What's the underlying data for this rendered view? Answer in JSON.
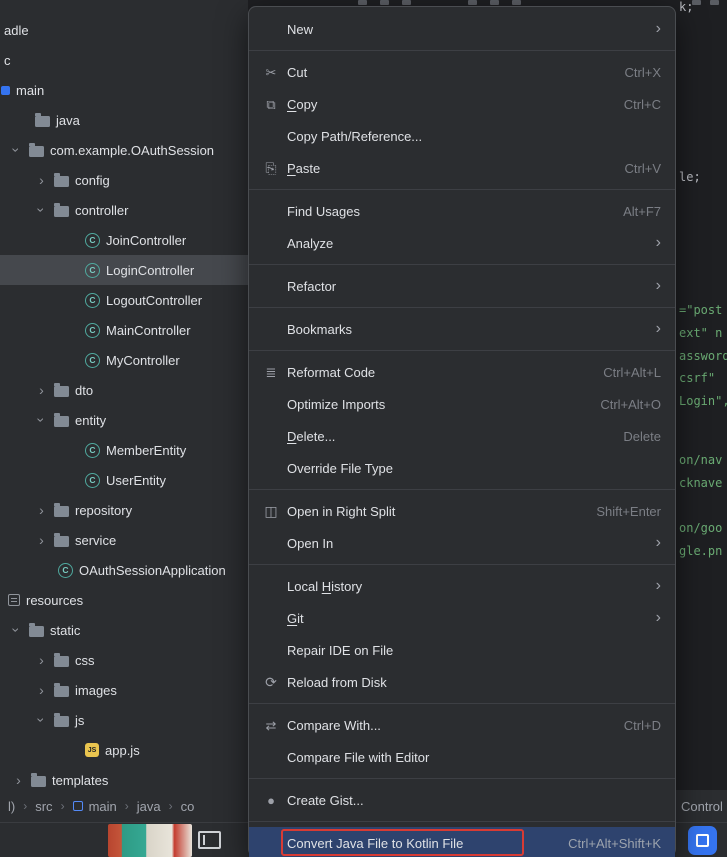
{
  "colors": {
    "panel_bg": "#2b2d30",
    "editor_bg": "#1e1f22",
    "menu_selection_blue": "#2e436e",
    "tree_selection_gray": "#45484d",
    "annotation_red": "#d83b34",
    "accent_blue": "#3574f0",
    "string_green": "#6aab73",
    "text_primary": "#dfe1e5",
    "text_muted": "#7b7e85"
  },
  "tree": {
    "items": [
      {
        "label": "adle"
      },
      {
        "label": "c"
      },
      {
        "label": "main"
      },
      {
        "label": "java"
      },
      {
        "label": "com.example.OAuthSession"
      },
      {
        "label": "config"
      },
      {
        "label": "controller"
      },
      {
        "label": "JoinController"
      },
      {
        "label": "LoginController",
        "selected": true
      },
      {
        "label": "LogoutController"
      },
      {
        "label": "MainController"
      },
      {
        "label": "MyController"
      },
      {
        "label": "dto"
      },
      {
        "label": "entity"
      },
      {
        "label": "MemberEntity"
      },
      {
        "label": "UserEntity"
      },
      {
        "label": "repository"
      },
      {
        "label": "service"
      },
      {
        "label": "OAuthSessionApplication"
      },
      {
        "label": "resources"
      },
      {
        "label": "static"
      },
      {
        "label": "css"
      },
      {
        "label": "images"
      },
      {
        "label": "js"
      },
      {
        "label": "app.js"
      },
      {
        "label": "templates"
      }
    ]
  },
  "context_menu": {
    "items": [
      {
        "label": "New",
        "submenu": true
      },
      {
        "label": "Cut",
        "shortcut": "Ctrl+X",
        "icon": "scissors"
      },
      {
        "label": "Copy",
        "shortcut": "Ctrl+C",
        "icon": "copy",
        "mnemonic": "C"
      },
      {
        "label": "Copy Path/Reference..."
      },
      {
        "label": "Paste",
        "shortcut": "Ctrl+V",
        "icon": "paste",
        "mnemonic": "P"
      },
      {
        "label": "Find Usages",
        "shortcut": "Alt+F7"
      },
      {
        "label": "Analyze",
        "submenu": true
      },
      {
        "label": "Refactor",
        "submenu": true
      },
      {
        "label": "Bookmarks",
        "submenu": true
      },
      {
        "label": "Reformat Code",
        "shortcut": "Ctrl+Alt+L",
        "icon": "reformat"
      },
      {
        "label": "Optimize Imports",
        "shortcut": "Ctrl+Alt+O"
      },
      {
        "label": "Delete...",
        "shortcut": "Delete",
        "mnemonic": "D"
      },
      {
        "label": "Override File Type"
      },
      {
        "label": "Open in Right Split",
        "shortcut": "Shift+Enter",
        "icon": "split"
      },
      {
        "label": "Open In",
        "submenu": true
      },
      {
        "label": "Local History",
        "submenu": true,
        "mnemonic": "H"
      },
      {
        "label": "Git",
        "submenu": true,
        "mnemonic": "G"
      },
      {
        "label": "Repair IDE on File"
      },
      {
        "label": "Reload from Disk",
        "icon": "reload"
      },
      {
        "label": "Compare With...",
        "shortcut": "Ctrl+D",
        "icon": "compare"
      },
      {
        "label": "Compare File with Editor"
      },
      {
        "label": "Create Gist...",
        "icon": "github"
      },
      {
        "label": "Convert Java File to Kotlin File",
        "shortcut": "Ctrl+Alt+Shift+K",
        "highlighted": true
      }
    ]
  },
  "breadcrumbs": {
    "items": [
      "l)",
      "src",
      "main",
      "java",
      "co"
    ],
    "right_fragment": "Control"
  },
  "editor": {
    "fragments": [
      {
        "text": "k;",
        "color": "#bcbec4"
      },
      {
        "text": "le;",
        "color": "#bcbec4"
      },
      {
        "text": "=\"post",
        "color": "#6aab73"
      },
      {
        "text": "ext\" n",
        "color": "#6aab73"
      },
      {
        "text": "assword",
        "color": "#6aab73"
      },
      {
        "text": "csrf\"",
        "color": "#6aab73"
      },
      {
        "text": "Login\",",
        "color": "#6aab73"
      },
      {
        "text": "on/nav",
        "color": "#6aab73"
      },
      {
        "text": "cknave",
        "color": "#6aab73"
      },
      {
        "text": "on/goo",
        "color": "#6aab73"
      },
      {
        "text": "gle.pn",
        "color": "#6aab73"
      }
    ]
  },
  "status_bar": {
    "icons": [
      "decorative-image",
      "device-icon",
      "plugin-icon"
    ]
  }
}
